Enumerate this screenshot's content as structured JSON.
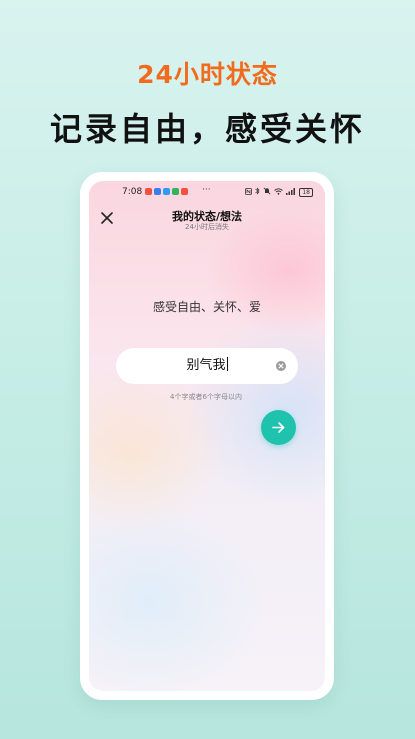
{
  "hero": {
    "subtitle": "24小时状态",
    "title": "记录自由，感受关怀"
  },
  "colors": {
    "accent_orange": "#f26b1d",
    "accent_teal": "#1fc3ad",
    "background": "#c4ece5"
  },
  "status_bar": {
    "time": "7:08",
    "more": "···",
    "battery": "18",
    "notification_icons": [
      "red-app-icon",
      "blue-app-icon",
      "blue-app-icon",
      "green-app-icon",
      "red-app-icon"
    ],
    "system_icons": [
      "nfc-icon",
      "bluetooth-icon",
      "mute-icon",
      "wifi-icon",
      "signal-icon",
      "battery-icon"
    ]
  },
  "header": {
    "title": "我的状态/想法",
    "subtitle": "24小时后消失",
    "close_icon": "close-icon"
  },
  "main": {
    "prompt": "感受自由、关怀、爱",
    "input_value": "别气我",
    "hint": "4个字或者6个字母以内",
    "clear_icon": "clear-icon",
    "next_icon": "arrow-right-icon"
  }
}
